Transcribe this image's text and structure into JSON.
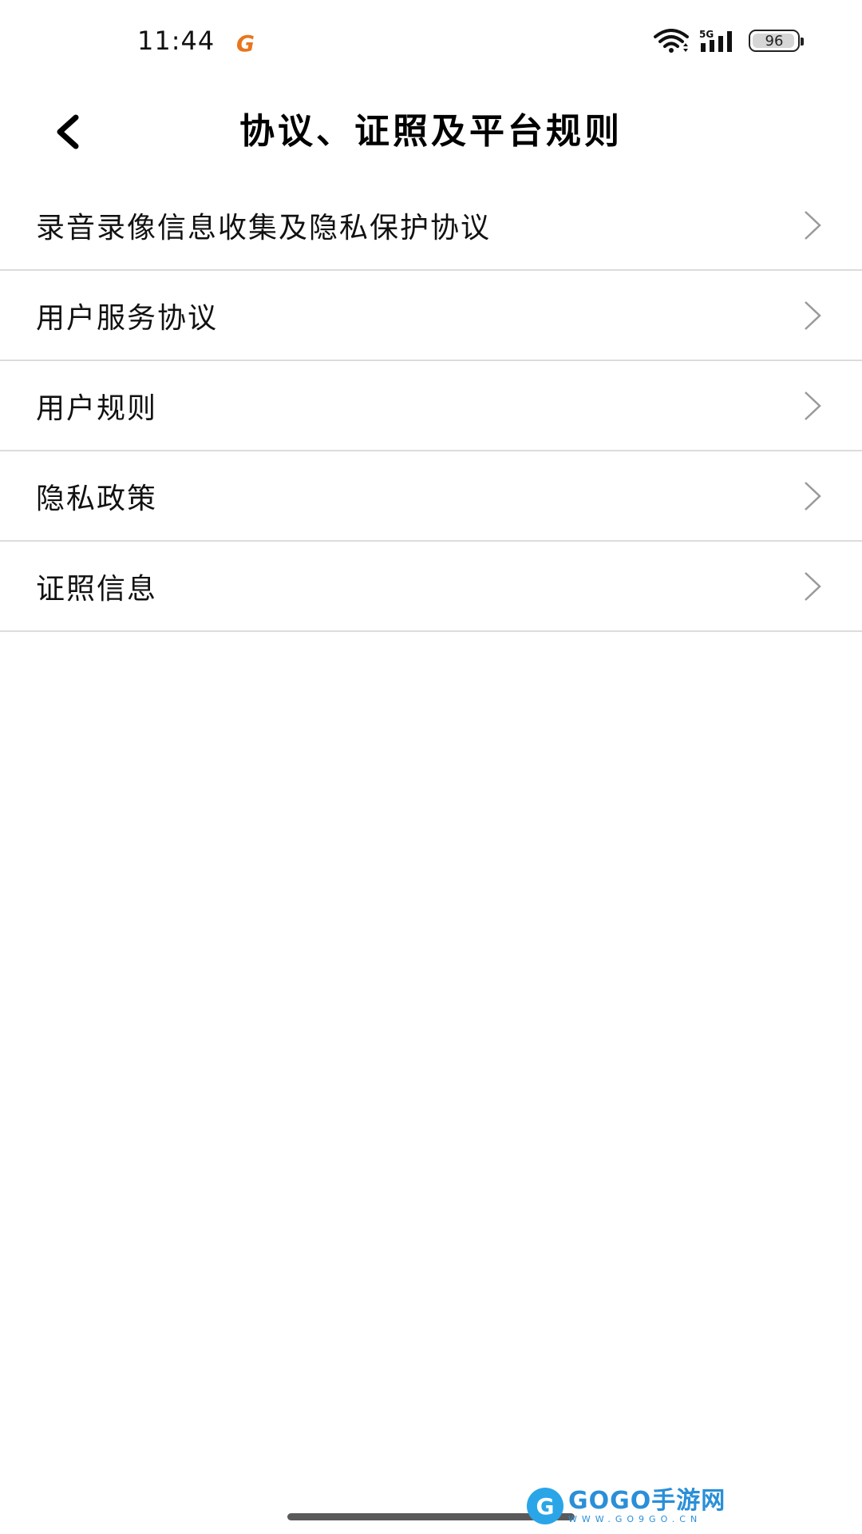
{
  "status_bar": {
    "time": "11:44",
    "app_icon_glyph": "G",
    "network_label": "5G",
    "battery": "96",
    "battery_level": 0.96,
    "app_icon_color": "#e8761e"
  },
  "header": {
    "title": "协议、证照及平台规则",
    "back_icon": "chevron-left-icon"
  },
  "list": {
    "items": [
      {
        "label": "录音录像信息收集及隐私保护协议"
      },
      {
        "label": "用户服务协议"
      },
      {
        "label": "用户规则"
      },
      {
        "label": "隐私政策"
      },
      {
        "label": "证照信息"
      }
    ],
    "divider_color": "#dcdcdc",
    "chevron_color": "#9a9a9a"
  },
  "watermark": {
    "logo_glyph": "G",
    "text": "GOGO手游网",
    "subtext": "WWW.GO9GO.CN"
  }
}
